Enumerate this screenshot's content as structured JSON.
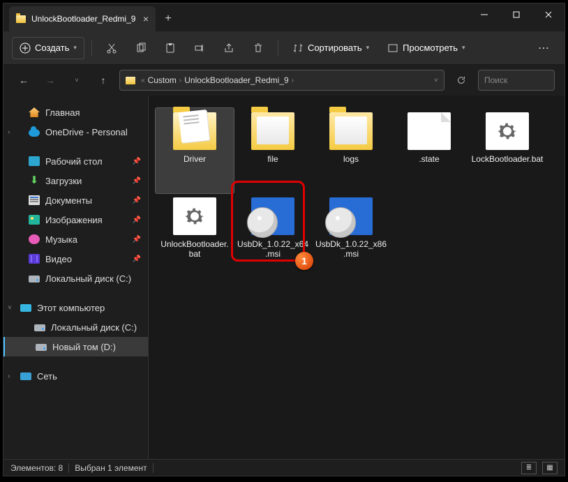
{
  "titlebar": {
    "tab_title": "UnlockBootloader_Redmi_9"
  },
  "toolbar": {
    "create": "Создать",
    "sort": "Сортировать",
    "view": "Просмотреть"
  },
  "breadcrumb": {
    "root_chev": "«",
    "seg1": "Custom",
    "seg2": "UnlockBootloader_Redmi_9"
  },
  "search": {
    "placeholder": "Поиск"
  },
  "sidebar": {
    "home": "Главная",
    "onedrive": "OneDrive - Personal",
    "desktop": "Рабочий стол",
    "downloads": "Загрузки",
    "documents": "Документы",
    "pictures": "Изображения",
    "music": "Музыка",
    "video": "Видео",
    "drive_c": "Локальный диск (C:)",
    "this_pc": "Этот компьютер",
    "drive_c2": "Локальный диск (C:)",
    "drive_d": "Новый том (D:)",
    "network": "Сеть"
  },
  "files": [
    {
      "name": "Driver"
    },
    {
      "name": "file"
    },
    {
      "name": "logs"
    },
    {
      "name": ".state"
    },
    {
      "name": "LockBootloader.bat"
    },
    {
      "name": "UnlockBootloader.bat"
    },
    {
      "name": "UsbDk_1.0.22_x64.msi"
    },
    {
      "name": "UsbDk_1.0.22_x86.msi"
    }
  ],
  "status": {
    "count": "Элементов: 8",
    "selected": "Выбран 1 элемент"
  },
  "callout_badge": "1"
}
